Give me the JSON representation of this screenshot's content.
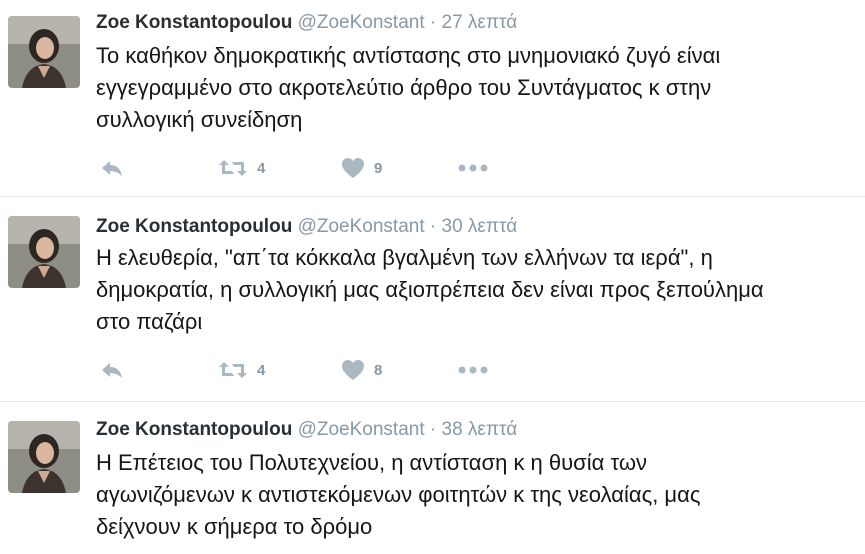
{
  "colors": {
    "name": "#292f33",
    "meta": "#8899a6",
    "text": "#14171a",
    "action": "#aab8c2",
    "divider": "#e1e8ed"
  },
  "icons": {
    "reply": "reply-icon",
    "retweet": "retweet-icon",
    "like": "heart-icon",
    "more": "more-icon",
    "avatar": "avatar"
  },
  "tweets": [
    {
      "name": "Zoe Konstantopoulou",
      "handle": "@ZoeKonstant",
      "separator": "·",
      "time": "27 λεπτά",
      "lines": [
        "Το καθήκον δημοκρατικής αντίστασης στο μνημονιακό ζυγό είναι",
        "εγγεγραμμένο στο ακροτελεύτιο άρθρο του Συντάγματος κ στην",
        "συλλογική συνείδηση"
      ],
      "retweets": "4",
      "likes": "9"
    },
    {
      "name": "Zoe Konstantopoulou",
      "handle": "@ZoeKonstant",
      "separator": "·",
      "time": "30 λεπτά",
      "lines": [
        "Η ελευθερία, \"απ΄τα κόκκαλα βγαλμένη των ελλήνων τα ιερά\", η",
        "δημοκρατία, η συλλογική μας αξιοπρέπεια δεν είναι προς ξεπούλημα",
        "στο παζάρι"
      ],
      "retweets": "4",
      "likes": "8"
    },
    {
      "name": "Zoe Konstantopoulou",
      "handle": "@ZoeKonstant",
      "separator": "·",
      "time": "38 λεπτά",
      "lines": [
        "Η Επέτειος του Πολυτεχνείου, η αντίσταση κ η θυσία των",
        "αγωνιζόμενων κ αντιστεκόμενων φοιτητών κ της νεολαίας, μας",
        "δείχνουν κ σήμερα το δρόμο"
      ]
    }
  ]
}
